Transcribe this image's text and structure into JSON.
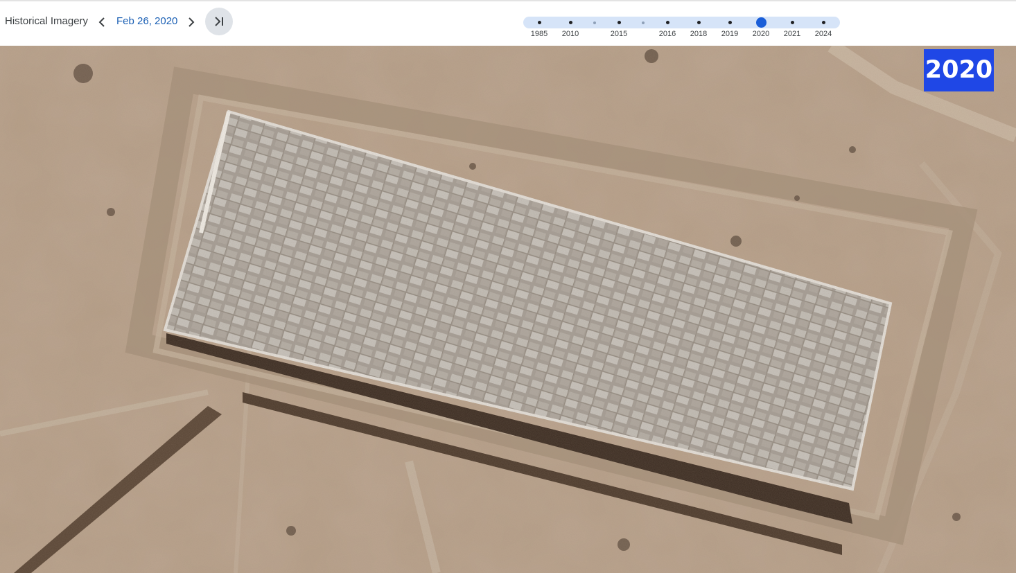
{
  "header": {
    "title": "Historical Imagery",
    "date": "Feb 26, 2020",
    "prev_icon": "chevron-left-icon",
    "next_icon": "chevron-right-icon",
    "jump_latest_icon": "skip-to-latest-icon"
  },
  "timeline": {
    "ticks": [
      {
        "label": "1985",
        "kind": "year"
      },
      {
        "label": "2010",
        "kind": "year"
      },
      {
        "label": "",
        "kind": "minor"
      },
      {
        "label": "2015",
        "kind": "year"
      },
      {
        "label": "",
        "kind": "minor"
      },
      {
        "label": "2016",
        "kind": "year"
      },
      {
        "label": "2018",
        "kind": "year"
      },
      {
        "label": "2019",
        "kind": "year"
      },
      {
        "label": "2020",
        "kind": "selected"
      },
      {
        "label": "2021",
        "kind": "year"
      },
      {
        "label": "2024",
        "kind": "year"
      }
    ],
    "selected": "2020"
  },
  "overlay": {
    "year_badge": "2020"
  },
  "colors": {
    "accent": "#1a5ed8",
    "badge": "#1f47e6",
    "track": "#d6e4f8",
    "date_text": "#1a5fb4"
  }
}
